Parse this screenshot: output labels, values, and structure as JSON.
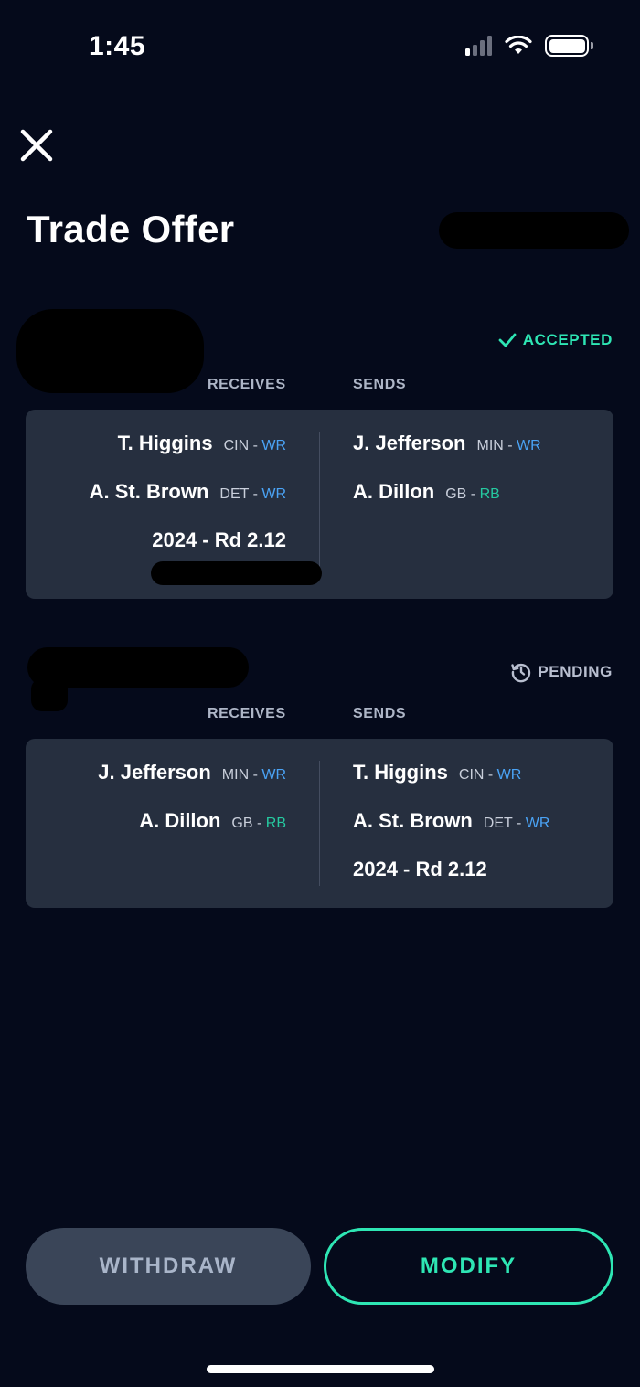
{
  "status_bar": {
    "time": "1:45"
  },
  "page_title": "Trade Offer",
  "trades": [
    {
      "status": "ACCEPTED",
      "receives_label": "RECEIVES",
      "sends_label": "SENDS",
      "receives": [
        {
          "name": "T. Higgins",
          "team": "CIN",
          "pos": "WR"
        },
        {
          "name": "A. St. Brown",
          "team": "DET",
          "pos": "WR"
        }
      ],
      "receives_pick": "2024 - Rd 2.12",
      "sends": [
        {
          "name": "J. Jefferson",
          "team": "MIN",
          "pos": "WR"
        },
        {
          "name": "A. Dillon",
          "team": "GB",
          "pos": "RB"
        }
      ]
    },
    {
      "status": "PENDING",
      "receives_label": "RECEIVES",
      "sends_label": "SENDS",
      "receives": [
        {
          "name": "J. Jefferson",
          "team": "MIN",
          "pos": "WR"
        },
        {
          "name": "A. Dillon",
          "team": "GB",
          "pos": "RB"
        }
      ],
      "sends": [
        {
          "name": "T. Higgins",
          "team": "CIN",
          "pos": "WR"
        },
        {
          "name": "A. St. Brown",
          "team": "DET",
          "pos": "WR"
        }
      ],
      "sends_pick": "2024 - Rd 2.12"
    }
  ],
  "actions": {
    "withdraw": "WITHDRAW",
    "modify": "MODIFY"
  },
  "colors": {
    "accent": "#2ee6b4",
    "wr": "#4aa3f5",
    "rb": "#25c9a0",
    "card": "#262f3f",
    "background": "#050a1b"
  }
}
